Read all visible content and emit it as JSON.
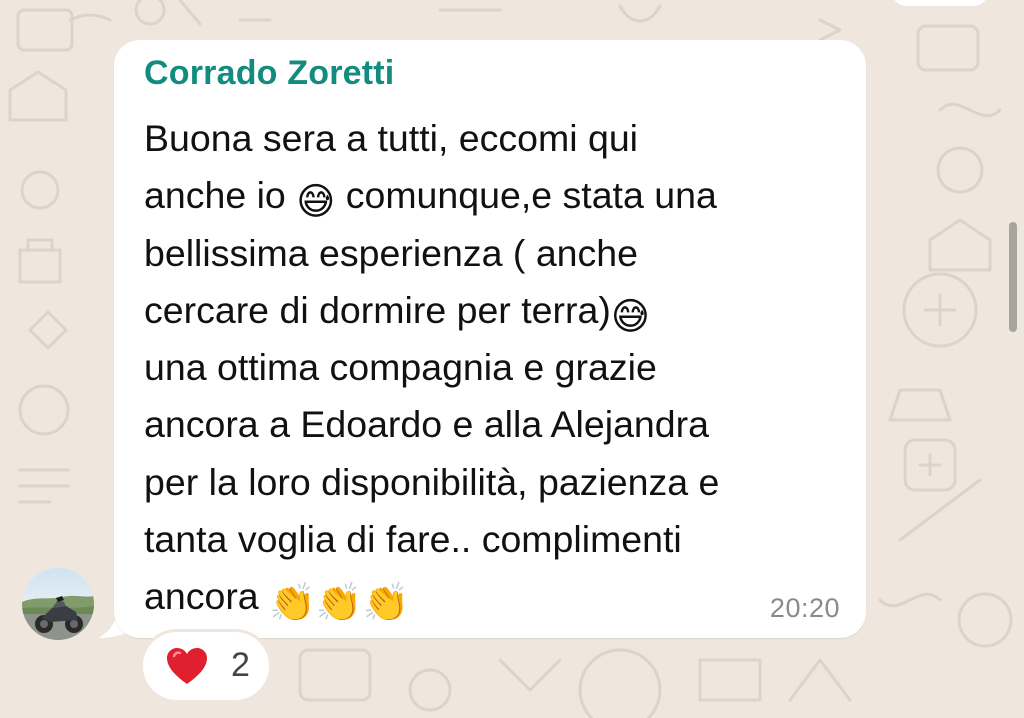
{
  "message": {
    "sender": "Corrado Zoretti",
    "lines": [
      {
        "text": "Buona sera a tutti, eccomi qui",
        "emoji": ""
      },
      {
        "text": "anche io ",
        "emoji": "😅",
        "after": " comunque,e stata una"
      },
      {
        "text": "bellissima esperienza ( anche",
        "emoji": ""
      },
      {
        "text": "cercare di dormire per terra)",
        "emoji": "😅"
      },
      {
        "text": "una ottima compagnia e grazie",
        "emoji": ""
      },
      {
        "text": "ancora a Edoardo e alla Alejandra",
        "emoji": ""
      },
      {
        "text": "per la loro disponibilità, pazienza e",
        "emoji": ""
      },
      {
        "text": "tanta voglia di fare.. complimenti",
        "emoji": ""
      },
      {
        "text": "ancora ",
        "emoji": "👏👏👏"
      }
    ],
    "time": "20:20"
  },
  "reaction": {
    "emoji": "❤️",
    "count": "2"
  },
  "icons": {
    "avatar": "avatar-motorcycle-photo",
    "reaction": "heart-icon",
    "emojis": [
      "grinning-sweat-emoji",
      "clapping-hands-emoji"
    ]
  },
  "colors": {
    "background": "#efe7dd",
    "bubble": "#ffffff",
    "sender": "#128c7e",
    "text": "#111111",
    "timestamp": "#8a8a8a",
    "heart": "#e0202e"
  }
}
